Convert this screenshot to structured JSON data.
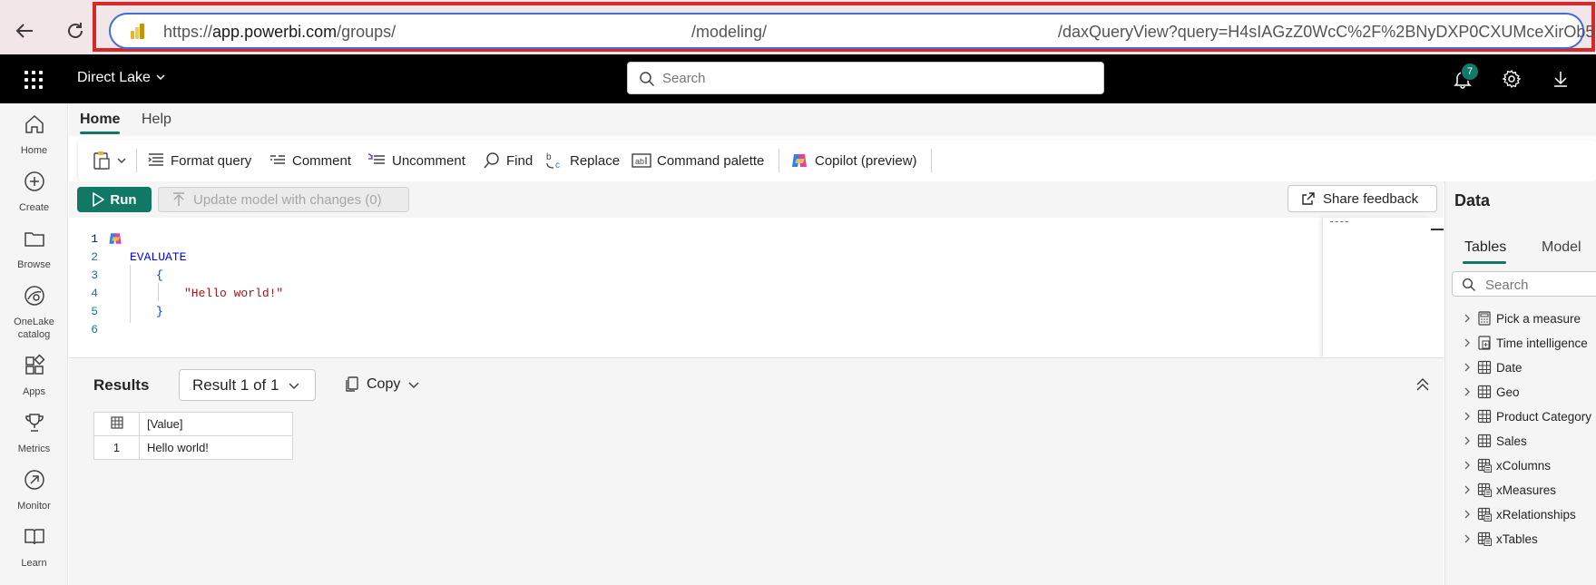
{
  "browser": {
    "url_prefix": "https://",
    "url_domain": "app.powerbi.com",
    "url_path_1": "/groups/",
    "url_path_2": "/modeling/",
    "url_path_3": "/daxQueryView?query=H4sIAGzZ0WcC%2F%2BNyDXP0CXUMceXirOb5"
  },
  "header": {
    "workspace": "Direct Lake",
    "search_placeholder": "Search",
    "notification_count": "7"
  },
  "rail": {
    "items": [
      {
        "label": "Home",
        "icon": "home-icon"
      },
      {
        "label": "Create",
        "icon": "plus-circle-icon"
      },
      {
        "label": "Browse",
        "icon": "folder-icon"
      },
      {
        "label": "OneLake catalog",
        "icon": "onelake-icon"
      },
      {
        "label": "Apps",
        "icon": "apps-icon"
      },
      {
        "label": "Metrics",
        "icon": "trophy-icon"
      },
      {
        "label": "Monitor",
        "icon": "monitor-icon"
      },
      {
        "label": "Learn",
        "icon": "book-icon"
      }
    ]
  },
  "ribbon": {
    "tabs": [
      "Home",
      "Help"
    ],
    "buttons": {
      "format": "Format query",
      "comment": "Comment",
      "uncomment": "Uncomment",
      "find": "Find",
      "replace": "Replace",
      "command": "Command palette",
      "copilot": "Copilot (preview)"
    }
  },
  "actions": {
    "run": "Run",
    "update": "Update model with changes (0)",
    "feedback": "Share feedback"
  },
  "editor": {
    "line_numbers": [
      "1",
      "2",
      "3",
      "4",
      "5",
      "6"
    ],
    "lines": [
      "",
      "EVALUATE",
      "{",
      "\"Hello world!\"",
      "}",
      ""
    ]
  },
  "results": {
    "title": "Results",
    "selector": "Result 1 of 1",
    "copy": "Copy",
    "columns": [
      "[Value]"
    ],
    "rows": [
      {
        "index": "1",
        "value": "Hello world!"
      }
    ]
  },
  "data_pane": {
    "title": "Data",
    "tabs": [
      "Tables",
      "Model"
    ],
    "search_placeholder": "Search",
    "items": [
      {
        "label": "Pick a measure",
        "icon": "calculator-icon"
      },
      {
        "label": "Time intelligence",
        "icon": "calc-group-icon"
      },
      {
        "label": "Date",
        "icon": "table-icon"
      },
      {
        "label": "Geo",
        "icon": "table-icon"
      },
      {
        "label": "Product Category",
        "icon": "table-icon"
      },
      {
        "label": "Sales",
        "icon": "table-icon"
      },
      {
        "label": "xColumns",
        "icon": "calc-table-icon"
      },
      {
        "label": "xMeasures",
        "icon": "calc-table-icon"
      },
      {
        "label": "xRelationships",
        "icon": "calc-table-icon"
      },
      {
        "label": "xTables",
        "icon": "calc-table-icon"
      }
    ]
  },
  "colors": {
    "accent": "#117865",
    "header_bg": "#000000",
    "highlight": "#d62929"
  }
}
